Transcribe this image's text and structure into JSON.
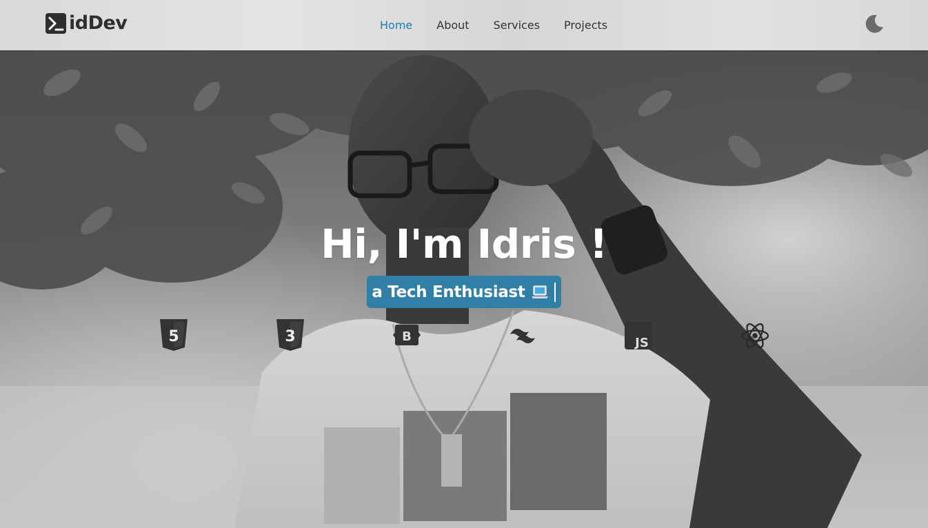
{
  "app": {
    "title": "idDev"
  },
  "navbar": {
    "logo_text": "idDev",
    "logo_icon": "terminal-icon",
    "links": [
      {
        "label": "Home",
        "active": true
      },
      {
        "label": "About",
        "active": false
      },
      {
        "label": "Services",
        "active": false
      },
      {
        "label": "Projects",
        "active": false
      }
    ],
    "theme_toggle_icon": "moon-icon"
  },
  "hero": {
    "title": "Hi, I'm Idris !",
    "subtitle": "a Tech Enthusiast",
    "subtitle_emoji_icon": "laptop-icon",
    "tech_icons": [
      {
        "name": "html5-icon",
        "label": "5"
      },
      {
        "name": "css3-icon",
        "label": "3"
      },
      {
        "name": "bootstrap-icon",
        "label": "B"
      },
      {
        "name": "tailwind-icon",
        "label": ""
      },
      {
        "name": "javascript-icon",
        "label": "JS"
      },
      {
        "name": "react-icon",
        "label": ""
      }
    ]
  },
  "colors": {
    "accent": "#1f7ab8",
    "subtitle_bg": "#2f7fa6",
    "nav_text": "#333333",
    "logo_text": "#2e2e2e",
    "hero_text": "#ffffff",
    "icon_dark": "#333333"
  }
}
